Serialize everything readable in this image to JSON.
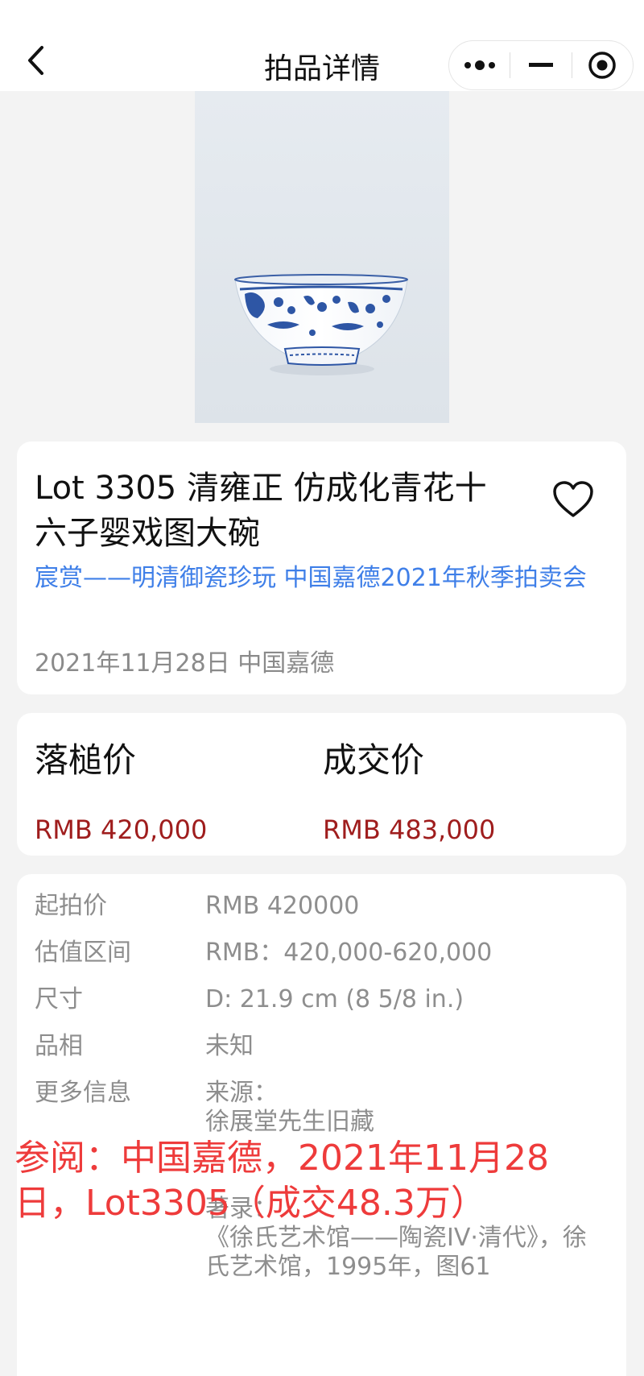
{
  "header": {
    "title": "拍品详情",
    "back_icon": "chevron-left-icon",
    "capsule": [
      "more-dots-icon",
      "minimize-icon",
      "record-target-icon"
    ]
  },
  "hero": {
    "alt": "blue-and-white porcelain bowl image"
  },
  "lot": {
    "name": "Lot 3305 清雍正 仿成化青花十六子婴戏图大碗",
    "auction": "宸赏——明清御瓷珍玩 中国嘉德2021年秋季拍卖会",
    "date_house": "2021年11月28日 中国嘉德",
    "favorite_icon": "heart-outline-icon"
  },
  "prices": {
    "hammer_label": "落槌价",
    "hammer_value": "RMB 420,000",
    "final_label": "成交价",
    "final_value": "RMB 483,000",
    "value_color": "#9f1d1d"
  },
  "info": [
    {
      "label": "起拍价",
      "value": "RMB 420000"
    },
    {
      "label": "估值区间",
      "value": "RMB：420,000-620,000"
    },
    {
      "label": "尺寸",
      "value": "D: 21.9 cm (8 5/8 in.)"
    },
    {
      "label": "品相",
      "value": "未知"
    },
    {
      "label": "更多信息",
      "value": "来源：\n徐展堂先生旧藏\n\n\n著录：\n《徐氏艺术馆——陶瓷IV·清代》，徐氏艺术馆，1995年，图61"
    }
  ],
  "overlay": {
    "text": "参阅：中国嘉德，2021年11月28日，Lot3305（成交48.3万）",
    "color": "#ee3b3b"
  }
}
